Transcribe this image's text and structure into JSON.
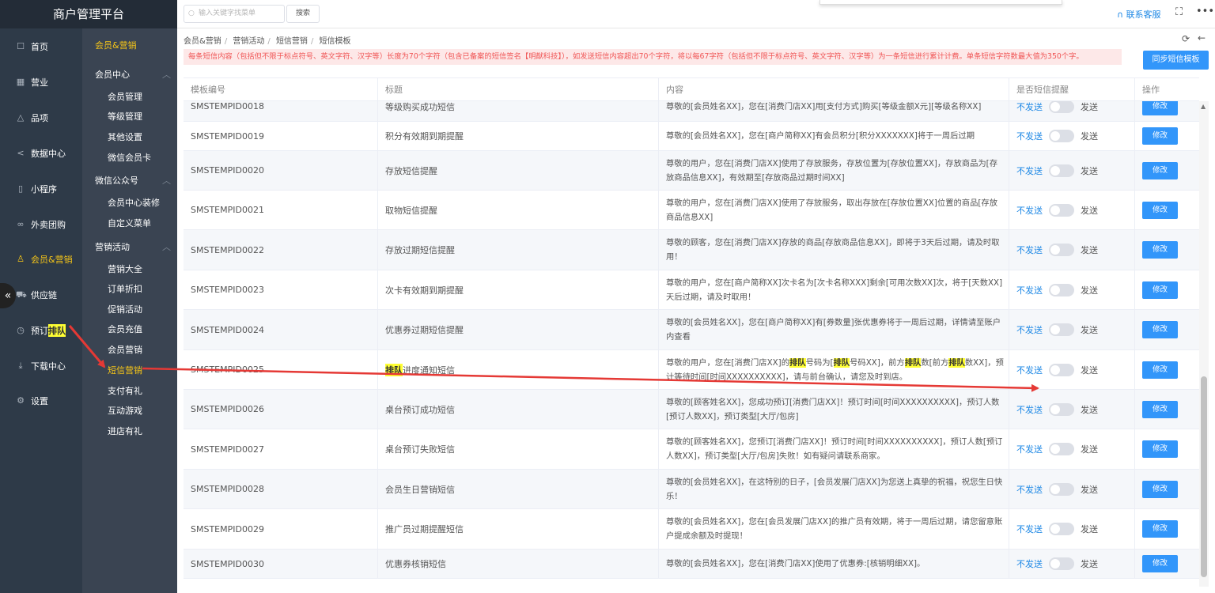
{
  "app": {
    "title": "商户管理平台"
  },
  "topbar": {
    "search_placeholder": "输入关键字找菜单",
    "search_button": "搜索",
    "contact": "联系客服"
  },
  "nav": [
    {
      "label": "首页",
      "icon": "home-icon"
    },
    {
      "label": "营业",
      "icon": "calendar-icon"
    },
    {
      "label": "品项",
      "icon": "bag-icon"
    },
    {
      "label": "数据中心",
      "icon": "share-icon"
    },
    {
      "label": "小程序",
      "icon": "phone-icon"
    },
    {
      "label": "外卖团购",
      "icon": "group-icon"
    },
    {
      "label": "会员&营销",
      "icon": "user-icon"
    },
    {
      "label": "供应链",
      "icon": "truck-icon"
    },
    {
      "label": "预订排队",
      "label_plain": "预订",
      "label_hl": "排队",
      "icon": "clock-icon"
    },
    {
      "label": "下载中心",
      "icon": "download-icon"
    },
    {
      "label": "设置",
      "icon": "settings-icon"
    }
  ],
  "subnav": {
    "title": "会员&营销",
    "groups": [
      {
        "label": "会员中心",
        "items": [
          "会员管理",
          "等级管理",
          "其他设置",
          "微信会员卡"
        ]
      },
      {
        "label": "微信公众号",
        "items": [
          "会员中心装修",
          "自定义菜单"
        ]
      },
      {
        "label": "营销活动",
        "items": [
          "营销大全",
          "订单折扣",
          "促销活动",
          "会员充值",
          "会员营销",
          "短信营销",
          "支付有礼",
          "互动游戏",
          "进店有礼"
        ]
      }
    ]
  },
  "breadcrumb": [
    "会员&营销",
    "营销活动",
    "短信营销",
    "短信模板"
  ],
  "notice": "每条短信内容（包括但不限于标点符号、英文字符、汉字等）长度为70个字符（包含已备案的短信签名【明猷科技】），如发送短信内容超出70个字符，将以每67字符（包括但不限于标点符号、英文字符、汉字等）为一条短信进行累计计费。单条短信字符数最大值为350个字。",
  "sync_button": "同步短信模板",
  "table": {
    "headers": [
      "模板编号",
      "标题",
      "内容",
      "是否短信提醒",
      "操作"
    ],
    "switch_off": "不发送",
    "switch_on": "发送",
    "edit": "修改",
    "rows": [
      {
        "id": "SMSTEMPID0018",
        "title": "等级购买成功短信",
        "content": "尊敬的[会员姓名XX]，您在[消费门店XX]用[支付方式]购买[等级金额X元][等级名称XX]"
      },
      {
        "id": "SMSTEMPID0019",
        "title": "积分有效期到期提醒",
        "content": "尊敬的[会员姓名XX]，您在[商户简称XX]有会员积分[积分XXXXXXX]将于一周后过期"
      },
      {
        "id": "SMSTEMPID0020",
        "title": "存放短信提醒",
        "content": "尊敬的用户，您在[消费门店XX]使用了存放服务，存放位置为[存放位置XX]，存放商品为[存放商品信息XX]，有效期至[存放商品过期时间XX]"
      },
      {
        "id": "SMSTEMPID0021",
        "title": "取物短信提醒",
        "content": "尊敬的用户，您在[消费门店XX]使用了存放服务，取出存放在[存放位置XX]位置的商品[存放商品信息XX]"
      },
      {
        "id": "SMSTEMPID0022",
        "title": "存放过期短信提醒",
        "content": "尊敬的顾客，您在[消费门店XX]存放的商品[存放商品信息XX]，即将于3天后过期，请及时取用！"
      },
      {
        "id": "SMSTEMPID0023",
        "title": "次卡有效期到期提醒",
        "content": "尊敬的用户，您在[商户简称XX]次卡名为[次卡名称XXX]剩余[可用次数XX]次，将于[天数XX]天后过期，请及时取用！"
      },
      {
        "id": "SMSTEMPID0024",
        "title": "优惠券过期短信提醒",
        "content": "尊敬的[会员姓名XX]，您在[商户简称XX]有[券数量]张优惠券将于一周后过期，详情请至账户内查看"
      },
      {
        "id": "SMSTEMPID0025",
        "title": "排队进度通知短信",
        "title_hl": "排队",
        "title_rest": "进度通知短信",
        "content": "尊敬的用户，您在[消费门店XX]的排队号码为[排队号码XX]，前方排队数[前方排队数XX]，预计等待时间[时间XXXXXXXXXX]，请与前台确认，请您及时到店。"
      },
      {
        "id": "SMSTEMPID0026",
        "title": "桌台预订成功短信",
        "content": "尊敬的[顾客姓名XX]，您成功预订[消费门店XX]！预订时间[时间XXXXXXXXXX]，预订人数[预订人数XX]，预订类型[大厅/包房]"
      },
      {
        "id": "SMSTEMPID0027",
        "title": "桌台预订失败短信",
        "content": "尊敬的[顾客姓名XX]，您预订[消费门店XX]！预订时间[时间XXXXXXXXXX]，预订人数[预订人数XX]，预订类型[大厅/包房]失败！如有疑问请联系商家。"
      },
      {
        "id": "SMSTEMPID0028",
        "title": "会员生日营销短信",
        "content": "尊敬的[会员姓名XX]，在这特别的日子，[会员发展门店XX]为您送上真挚的祝福，祝您生日快乐！"
      },
      {
        "id": "SMSTEMPID0029",
        "title": "推广员过期提醒短信",
        "content": "尊敬的[会员姓名XX]，您在[会员发展门店XX]的推广员有效期，将于一周后过期，请您留意账户提成余额及时提现！"
      },
      {
        "id": "SMSTEMPID0030",
        "title": "优惠券核销短信",
        "content": "尊敬的[会员姓名XX]，您在[消费门店XX]使用了优惠券:[核销明细XX]。"
      }
    ]
  },
  "annotation_color": "#e53935",
  "highlight_color": "#ffff33",
  "accent_color": "#3296fa"
}
